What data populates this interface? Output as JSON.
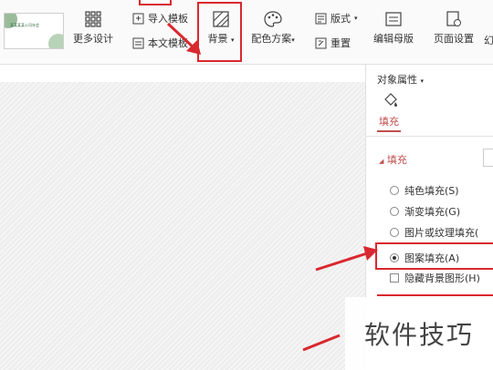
{
  "toolbar": {
    "thumb_title": "某某某某公司年会",
    "more_design": "更多设计",
    "import_template": "导入模板",
    "text_template": "本文模板",
    "background": "背景",
    "color_scheme": "配色方案",
    "layout": "版式",
    "reset": "重置",
    "edit_master": "编辑母版",
    "page_setup": "页面设置",
    "next_partial": "幻"
  },
  "panel": {
    "title": "对象属性",
    "tab_fill": "填充",
    "section_fill": "填充",
    "options": [
      {
        "label": "纯色填充(S)",
        "selected": false
      },
      {
        "label": "渐变填充(G)",
        "selected": false
      },
      {
        "label": "图片或纹理填充(",
        "selected": false
      },
      {
        "label": "图案填充(A)",
        "selected": true
      }
    ],
    "hide_bg": "隐藏背景图形(H)"
  },
  "watermark": "软件技巧",
  "colors": {
    "accent": "#d9282f",
    "link": "#c0504d"
  }
}
